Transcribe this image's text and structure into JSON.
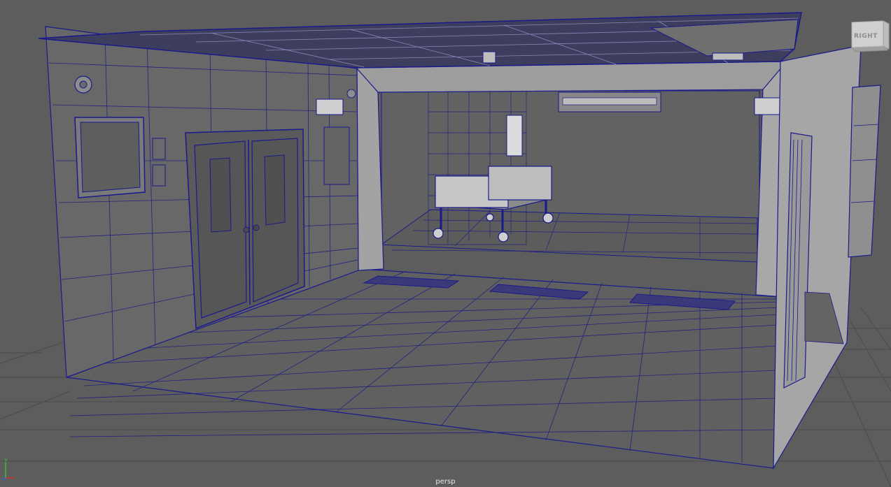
{
  "viewport": {
    "camera_name": "persp",
    "viewcube_face": "RIGHT",
    "axis_label": "y",
    "colors": {
      "background": "#5d5d5d",
      "wireframe": "#17178a",
      "grid": "#4d4d4d",
      "wall": "#737373",
      "pillar": "#9a9a9a"
    }
  },
  "scene_objects": [
    "ceiling",
    "left-wall",
    "double-door",
    "picture-frame",
    "vent-fan",
    "hospital-bed",
    "back-wall",
    "pillar-left",
    "pillar-right",
    "floor-tiles",
    "floor-vents",
    "side-panel"
  ]
}
